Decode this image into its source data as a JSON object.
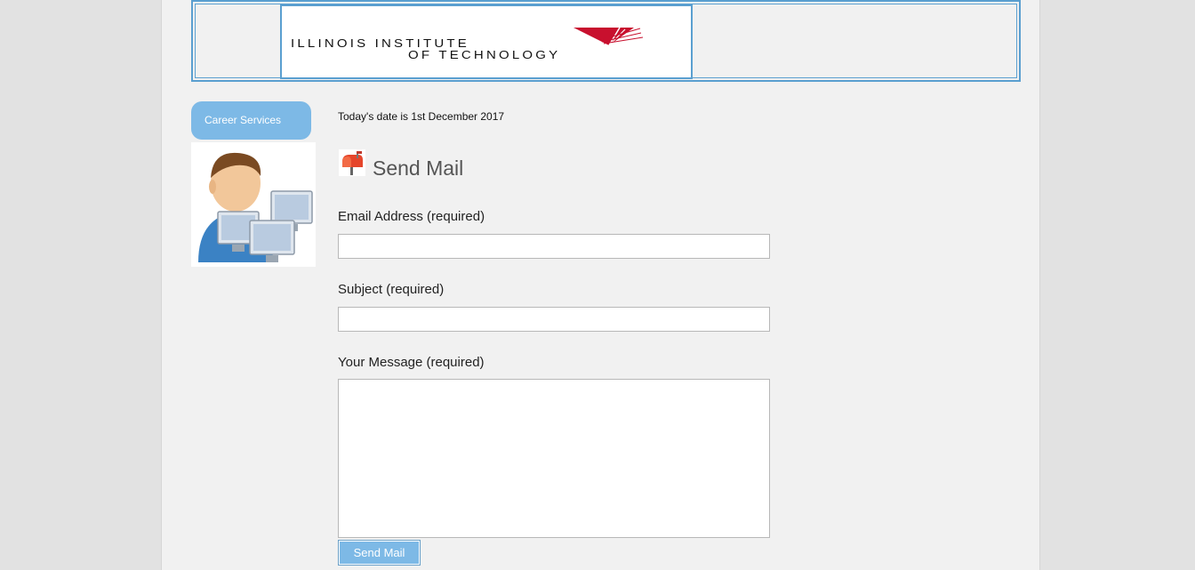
{
  "header": {
    "logo": {
      "line1": "ILLINOIS INSTITUTE",
      "line2": "OF TECHNOLOGY",
      "accent_color": "#c8102e"
    }
  },
  "sidebar": {
    "nav_label": "Career Services",
    "avatar_icon": "user-with-computers-icon"
  },
  "main": {
    "date_text": "Today's date is 1st December 2017",
    "section_icon": "mailbox-icon",
    "section_title": "Send Mail",
    "form": {
      "email": {
        "label": "Email Address (required)",
        "value": ""
      },
      "subject": {
        "label": "Subject (required)",
        "value": ""
      },
      "message": {
        "label": "Your Message (required)",
        "value": ""
      },
      "submit_label": "Send Mail"
    }
  },
  "colors": {
    "accent_blue": "#7db9e6",
    "frame_blue": "#5a9fd0",
    "page_bg": "#f1f1f1"
  }
}
